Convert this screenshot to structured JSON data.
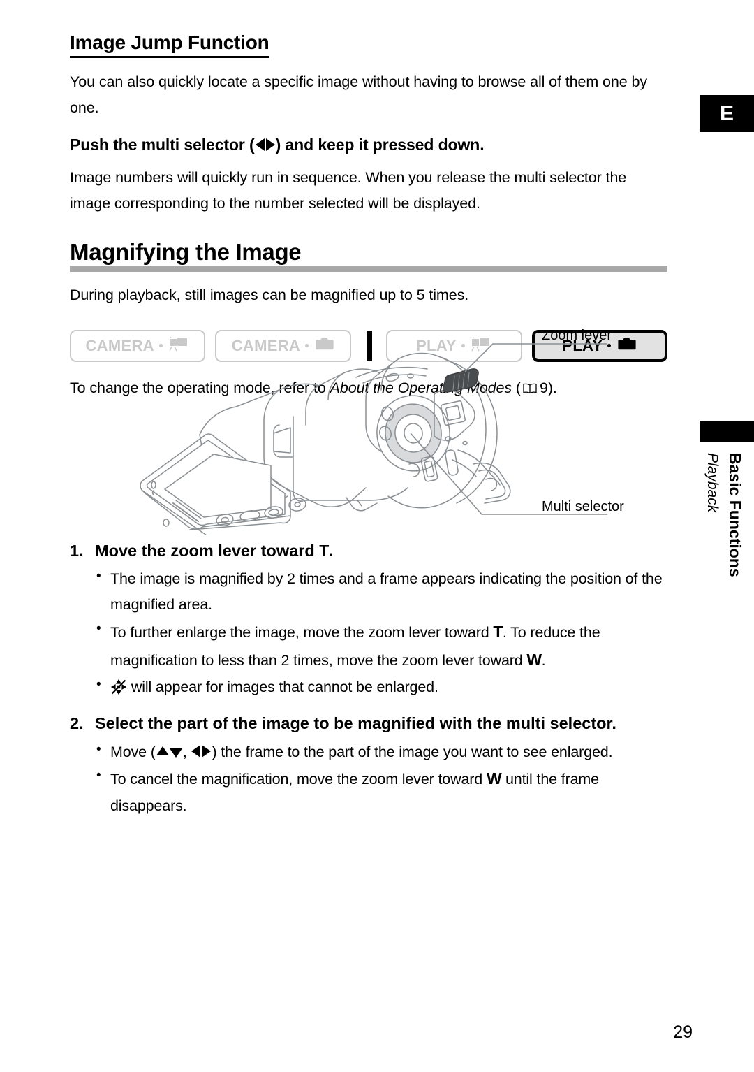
{
  "page": {
    "number": "29",
    "language_marker": "E"
  },
  "side_tab": {
    "chapter": "Basic Functions",
    "section": "Playback"
  },
  "sections": [
    {
      "id": "image-jump",
      "heading": "Image Jump Function",
      "intro": "You can also quickly locate a specific image without having to browse all of them one by one.",
      "instruction_prefix": "Push the multi selector (",
      "instruction_suffix": ") and keep it pressed down.",
      "detail": "Image numbers will quickly run in sequence. When you release the multi selector the image corresponding to the number selected will be displayed."
    },
    {
      "id": "magnifying",
      "heading": "Magnifying the Image",
      "intro": "During playback, still images can be magnified up to 5 times."
    }
  ],
  "mode_badges": {
    "items": [
      {
        "label": "CAMERA",
        "icon": "movie-camera-icon",
        "state": "inactive"
      },
      {
        "label": "CAMERA",
        "icon": "photo-camera-icon",
        "state": "inactive"
      },
      {
        "label": "PLAY",
        "icon": "movie-camera-icon",
        "state": "inactive"
      },
      {
        "label": "PLAY",
        "icon": "photo-camera-icon",
        "state": "active"
      }
    ],
    "note_prefix": "To change the operating mode, refer to ",
    "note_italic": "About the Operating Modes",
    "note_open_paren": " (",
    "note_page": "9",
    "note_close": ")."
  },
  "illustration": {
    "callouts": [
      {
        "name": "zoom-lever",
        "label": "Zoom lever"
      },
      {
        "name": "multi-selector",
        "label": "Multi selector"
      }
    ]
  },
  "steps": [
    {
      "number": "1.",
      "title_prefix": "Move the zoom lever toward ",
      "title_key": "T",
      "title_suffix": ".",
      "bullets": [
        {
          "type": "plain",
          "text": "The image is magnified by 2 times and a frame appears indicating the position of the magnified area."
        },
        {
          "type": "keys",
          "part1": "To further enlarge the image, move the zoom lever toward ",
          "key1": "T",
          "part2": ". To reduce the magnification to less than 2 times, move the zoom lever toward ",
          "key2": "W",
          "part3": "."
        },
        {
          "type": "icon",
          "icon": "no-magnify-icon",
          "text": "will appear for images that cannot be enlarged."
        }
      ]
    },
    {
      "number": "2.",
      "title_prefix": "Select the part of the image to be magnified with the multi selector.",
      "title_key": "",
      "title_suffix": "",
      "bullets": [
        {
          "type": "arrows",
          "part1": "Move (",
          "part2": ", ",
          "part3": ") the frame to the part of the image you want to see enlarged."
        },
        {
          "type": "keys",
          "part1": "To cancel the magnification, move the zoom lever toward ",
          "key1": "W",
          "part2": " until the frame disappears.",
          "key2": "",
          "part3": ""
        }
      ]
    }
  ],
  "colors": {
    "rule_gray": "#a8a8a8",
    "badge_inactive": "#c9c9c9",
    "badge_active_fill": "#e2e2e2",
    "line_art": "#8a8f93"
  }
}
